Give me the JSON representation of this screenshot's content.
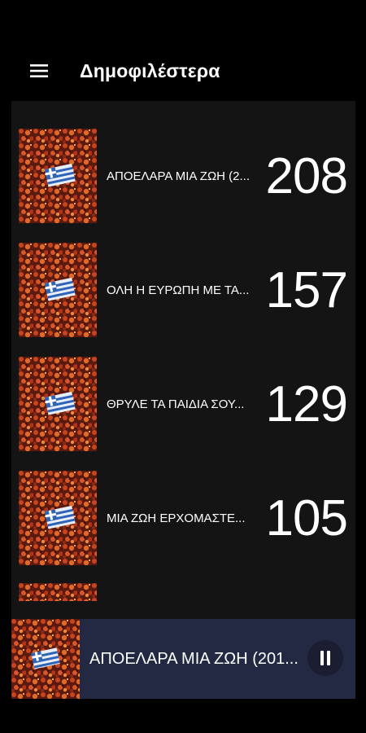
{
  "app": {
    "title": "Δημοφιλέστερα",
    "menu_icon": "hamburger-menu-icon"
  },
  "colors": {
    "background": "#000000",
    "list_panel": "#141414",
    "player_bar": "#232942",
    "text": "#ffffff"
  },
  "songs": [
    {
      "title": "ΑΠΟΕΛΑΡΑ ΜΙΑ ΖΩΗ (2...",
      "count": "208",
      "thumbnail": "greek-flag-crowd-image"
    },
    {
      "title": "ΟΛΗ Η ΕΥΡΩΠΗ ΜΕ ΤΑ...",
      "count": "157",
      "thumbnail": "greek-flag-crowd-image"
    },
    {
      "title": "ΘΡΥΛΕ ΤΑ ΠΑΙΔΙΑ ΣΟΥ...",
      "count": "129",
      "thumbnail": "greek-flag-crowd-image"
    },
    {
      "title": "ΜΙΑ ΖΩΗ ΕΡΧΟΜΑΣΤΕ...",
      "count": "105",
      "thumbnail": "greek-flag-crowd-image"
    }
  ],
  "player": {
    "title": "ΑΠΟΕΛΑΡΑ ΜΙΑ ΖΩΗ (201...",
    "state_icon": "pause-icon",
    "thumbnail": "greek-flag-crowd-image"
  }
}
